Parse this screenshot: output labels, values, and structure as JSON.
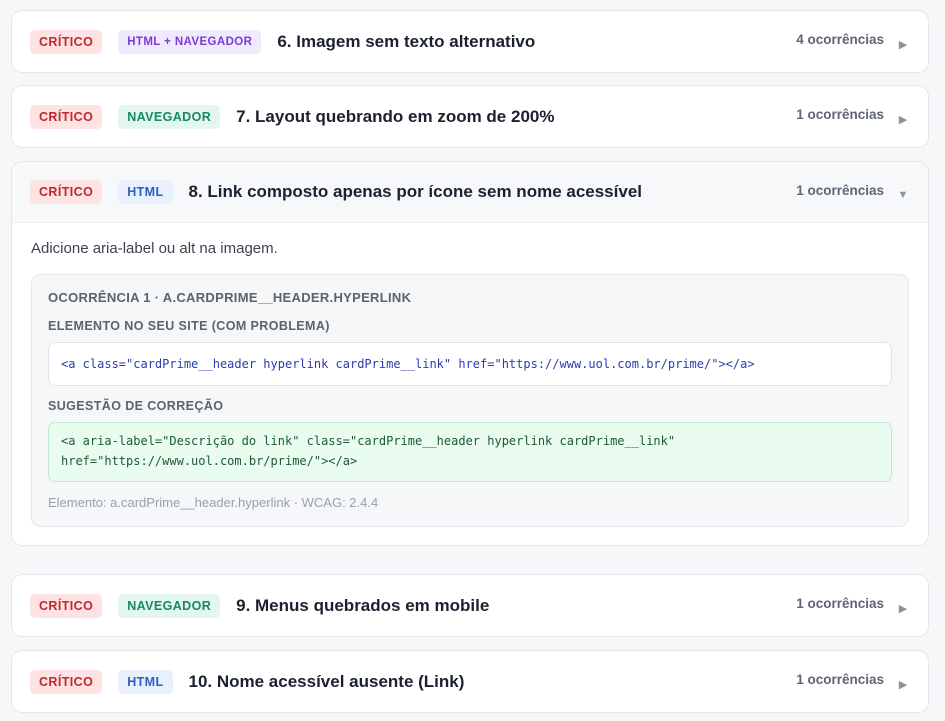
{
  "issues": [
    {
      "severity": "CRÍTICO",
      "category": "HTML + NAVEGADOR",
      "title": "6. Imagem sem texto alternativo",
      "count": "4 ocorrências",
      "chevron": "▶"
    },
    {
      "severity": "CRÍTICO",
      "category": "NAVEGADOR",
      "title": "7. Layout quebrando em zoom de 200%",
      "count": "1 ocorrências",
      "chevron": "▶"
    },
    {
      "severity": "CRÍTICO",
      "category": "HTML",
      "title": "8. Link composto apenas por ícone sem nome acessível",
      "count": "1 ocorrências",
      "chevron": "▼",
      "description": "Adicione aria-label ou alt na imagem.",
      "occurrence": {
        "title": "OCORRÊNCIA 1 · A.CARDPRIME__HEADER.HYPERLINK",
        "element_label": "ELEMENTO NO SEU SITE (COM PROBLEMA)",
        "element_code": "<a class=\"cardPrime__header hyperlink cardPrime__link\" href=\"https://www.uol.com.br/prime/\"></a>",
        "fix_label": "SUGESTÃO DE CORREÇÃO",
        "fix_code_line1": "<a aria-label=\"Descrição do link\" class=\"cardPrime__header hyperlink cardPrime__link\"",
        "fix_code_line2": "href=\"https://www.uol.com.br/prime/\"></a>",
        "meta": "Elemento: a.cardPrime__header.hyperlink · WCAG: 2.4.4"
      }
    },
    {
      "severity": "CRÍTICO",
      "category": "NAVEGADOR",
      "title": "9. Menus quebrados em mobile",
      "count": "1 ocorrências",
      "chevron": "▶"
    },
    {
      "severity": "CRÍTICO",
      "category": "HTML",
      "title": "10. Nome acessível ausente (Link)",
      "count": "1 ocorrências",
      "chevron": "▶"
    }
  ],
  "colors": {
    "critical_bg": "#fde3e3",
    "critical_text": "#c1272d",
    "html_navegador_text": "#7a3cd8",
    "navegador_text": "#178a5e",
    "html_text": "#2d5fbe",
    "fix_bg": "#eafbf0"
  },
  "icons": {
    "collapsed": "chevron-right-icon",
    "expanded": "chevron-down-icon"
  }
}
